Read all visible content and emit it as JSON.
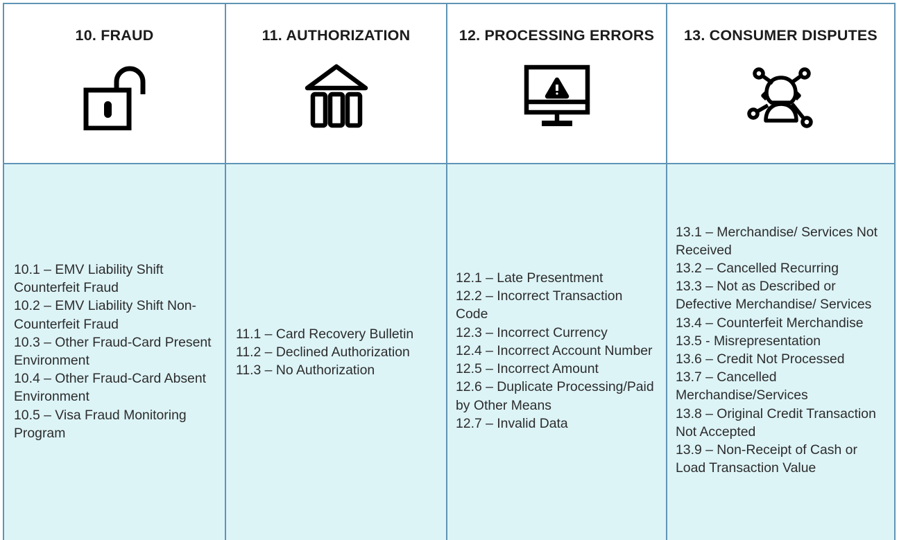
{
  "colors": {
    "grid_line": "#5f94b5",
    "body_background": "#ddf4f7",
    "header_background": "#ffffff",
    "header_text": "#1c1c1c",
    "body_text": "#2c2c2c",
    "icon_stroke": "#000000"
  },
  "columns": [
    {
      "title": "10. FRAUD",
      "icon": "open-padlock-icon",
      "codes": [
        "10.1 – EMV Liability Shift Counterfeit Fraud",
        "10.2 – EMV Liability Shift Non-Counterfeit Fraud",
        "10.3 – Other Fraud-Card Present Environment",
        "10.4 – Other Fraud-Card Absent Environment",
        "10.5 – Visa Fraud Monitoring Program"
      ]
    },
    {
      "title": "11. AUTHORIZATION",
      "icon": "bank-building-icon",
      "codes": [
        "11.1 – Card Recovery Bulletin",
        "11.2 – Declined Authorization",
        "11.3 – No Authorization"
      ]
    },
    {
      "title": "12. PROCESSING ERRORS",
      "icon": "monitor-warning-icon",
      "codes": [
        "12.1 – Late Presentment",
        "12.2 – Incorrect Transaction Code",
        "12.3 – Incorrect Currency",
        "12.4 – Incorrect Account Number",
        "12.5 – Incorrect Amount",
        "12.6 – Duplicate Processing/Paid by Other Means",
        "12.7 – Invalid Data"
      ]
    },
    {
      "title": "13. CONSUMER DISPUTES",
      "icon": "person-network-icon",
      "codes": [
        "13.1 – Merchandise/ Services Not Received",
        "13.2 – Cancelled Recurring",
        "13.3 – Not as Described or Defective Merchandise/ Services",
        "13.4 – Counterfeit Merchandise",
        "13.5 - Misrepresentation",
        "13.6 – Credit Not Processed",
        "13.7 – Cancelled Merchandise/Services",
        "13.8 – Original Credit Transaction Not Accepted",
        "13.9 – Non-Receipt of Cash or Load Transaction Value"
      ]
    }
  ]
}
